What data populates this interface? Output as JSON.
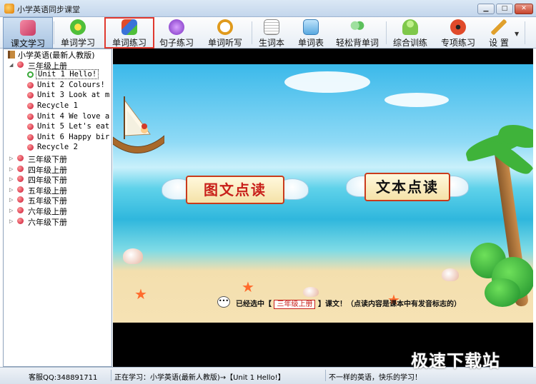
{
  "window": {
    "title": "小学英语同步课堂",
    "min": "▁",
    "max": "□",
    "close": "✕"
  },
  "toolbar": {
    "items": [
      {
        "label": "课文学习",
        "icon": "book-icon",
        "color": "#e0567a"
      },
      {
        "label": "单词学习",
        "icon": "flower-icon",
        "color": "#4fbf3a"
      },
      {
        "label": "单词练习",
        "icon": "pencils-icon",
        "color": "#3a72d8"
      },
      {
        "label": "句子练习",
        "icon": "microphone-icon",
        "color": "#9b4fd8"
      },
      {
        "label": "单词听写",
        "icon": "clock-icon",
        "color": "#e09a1c"
      },
      {
        "label": "生词本",
        "icon": "notebook-icon",
        "color": "#d8d8d8"
      },
      {
        "label": "单词表",
        "icon": "word-list-icon",
        "color": "#5aa9e0"
      },
      {
        "label": "轻松背单词",
        "icon": "people-icon",
        "color": "#5cc05c"
      },
      {
        "label": "综合训练",
        "icon": "figure-icon",
        "color": "#7fc84a"
      },
      {
        "label": "专项练习",
        "icon": "ladybug-icon",
        "color": "#e04a2a"
      },
      {
        "label": "设 置",
        "icon": "wrench-icon",
        "color": "#e0a02c"
      }
    ],
    "caret": "▼"
  },
  "tree": {
    "root": "小学英语(最新人教版)",
    "grades": [
      {
        "label": "三年级上册",
        "expanded": true
      },
      {
        "label": "三年级下册"
      },
      {
        "label": "四年级上册"
      },
      {
        "label": "四年级下册"
      },
      {
        "label": "五年级上册"
      },
      {
        "label": "五年级下册"
      },
      {
        "label": "六年级上册"
      },
      {
        "label": "六年级下册"
      }
    ],
    "units": [
      "Unit 1 Hello!",
      "Unit 2 Colours!",
      "Unit 3 Look at m",
      "Recycle 1",
      "Unit 4 We love a",
      "Unit 5 Let's eat",
      "Unit 6 Happy bir",
      "Recycle 2"
    ],
    "expand_open": "◢",
    "expand_closed": "▷"
  },
  "main": {
    "button_left": "图文点读",
    "button_right": "文本点读",
    "notice_prefix": "已经选中【",
    "notice_grade": "三年级上册",
    "notice_suffix": "】课文！（点读内容是课本中有发音标志的）"
  },
  "status": {
    "service": "客服QQ:348891711",
    "current": "正在学习：小学英语(最新人教版)→【Unit 1 Hello!】",
    "slogan": "不一样的英语，快乐的学习！"
  },
  "watermark": "极速下载站"
}
